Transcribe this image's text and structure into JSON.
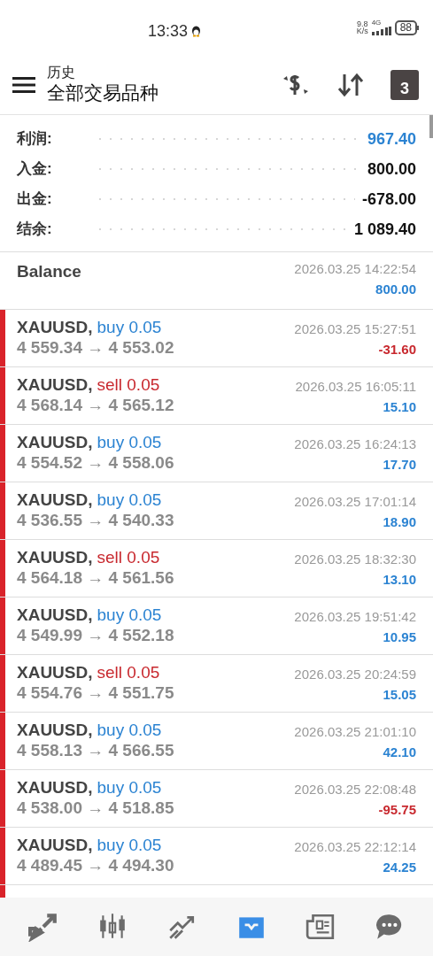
{
  "status_bar": {
    "time": "13:33",
    "net_speed_value": "9.8",
    "net_speed_unit": "K/s",
    "network": "4G",
    "battery": "88"
  },
  "header": {
    "subtitle": "历史",
    "title": "全部交易品种",
    "calendar_day": "3"
  },
  "summary": [
    {
      "label": "利润:",
      "value": "967.40",
      "highlight": true
    },
    {
      "label": "入金:",
      "value": "800.00",
      "highlight": false
    },
    {
      "label": "出金:",
      "value": "-678.00",
      "highlight": false
    },
    {
      "label": "结余:",
      "value": "1 089.40",
      "highlight": false
    }
  ],
  "balance": {
    "title": "Balance",
    "time": "2026.03.25 14:22:54",
    "amount": "800.00"
  },
  "trades": [
    {
      "symbol": "XAUUSD,",
      "kind": "buy",
      "order": "buy 0.05",
      "prices": "4 559.34 → 4 553.02",
      "time": "2026.03.25 15:27:51",
      "profit": "-31.60",
      "loss": true
    },
    {
      "symbol": "XAUUSD,",
      "kind": "sell",
      "order": "sell 0.05",
      "prices": "4 568.14 → 4 565.12",
      "time": "2026.03.25 16:05:11",
      "profit": "15.10",
      "loss": false
    },
    {
      "symbol": "XAUUSD,",
      "kind": "buy",
      "order": "buy 0.05",
      "prices": "4 554.52 → 4 558.06",
      "time": "2026.03.25 16:24:13",
      "profit": "17.70",
      "loss": false
    },
    {
      "symbol": "XAUUSD,",
      "kind": "buy",
      "order": "buy 0.05",
      "prices": "4 536.55 → 4 540.33",
      "time": "2026.03.25 17:01:14",
      "profit": "18.90",
      "loss": false
    },
    {
      "symbol": "XAUUSD,",
      "kind": "sell",
      "order": "sell 0.05",
      "prices": "4 564.18 → 4 561.56",
      "time": "2026.03.25 18:32:30",
      "profit": "13.10",
      "loss": false
    },
    {
      "symbol": "XAUUSD,",
      "kind": "buy",
      "order": "buy 0.05",
      "prices": "4 549.99 → 4 552.18",
      "time": "2026.03.25 19:51:42",
      "profit": "10.95",
      "loss": false
    },
    {
      "symbol": "XAUUSD,",
      "kind": "sell",
      "order": "sell 0.05",
      "prices": "4 554.76 → 4 551.75",
      "time": "2026.03.25 20:24:59",
      "profit": "15.05",
      "loss": false
    },
    {
      "symbol": "XAUUSD,",
      "kind": "buy",
      "order": "buy 0.05",
      "prices": "4 558.13 → 4 566.55",
      "time": "2026.03.25 21:01:10",
      "profit": "42.10",
      "loss": false
    },
    {
      "symbol": "XAUUSD,",
      "kind": "buy",
      "order": "buy 0.05",
      "prices": "4 538.00 → 4 518.85",
      "time": "2026.03.25 22:08:48",
      "profit": "-95.75",
      "loss": true
    },
    {
      "symbol": "XAUUSD,",
      "kind": "buy",
      "order": "buy 0.05",
      "prices": "4 489.45 → 4 494.30",
      "time": "2026.03.25 22:12:14",
      "profit": "24.25",
      "loss": false
    }
  ],
  "bottom_nav": [
    {
      "kind": "trade",
      "selected": false
    },
    {
      "kind": "chart",
      "selected": false
    },
    {
      "kind": "trend",
      "selected": false
    },
    {
      "kind": "history",
      "selected": true
    },
    {
      "kind": "news",
      "selected": false
    },
    {
      "kind": "chat",
      "selected": false
    }
  ]
}
